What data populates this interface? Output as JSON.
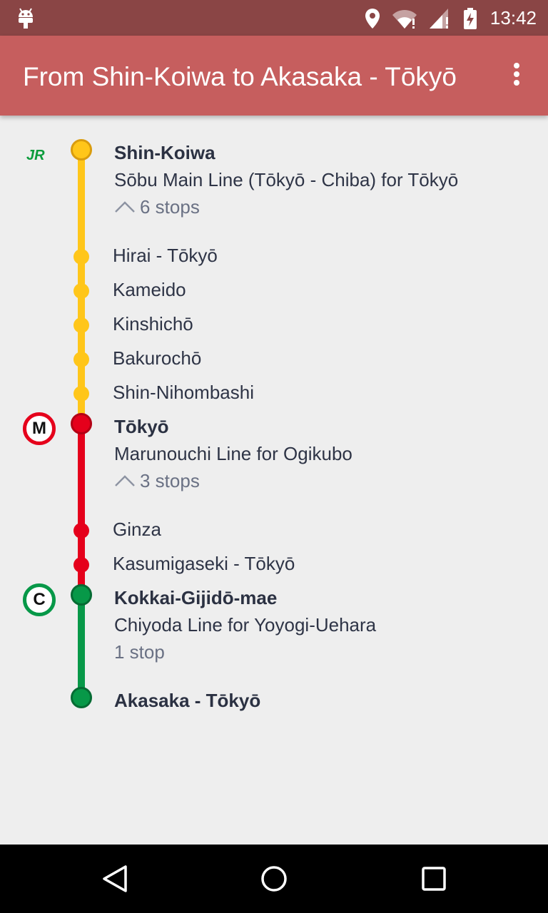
{
  "status_bar": {
    "time": "13:42"
  },
  "toolbar": {
    "title": "From Shin-Koiwa to Akasaka - Tōkyō"
  },
  "colors": {
    "sobu": "#ffc61a",
    "sobu_border": "#d99c0e",
    "marunouchi": "#e5001b",
    "marunouchi_border": "#b30015",
    "chiyoda": "#079848",
    "chiyoda_border": "#056b33"
  },
  "route": {
    "leg1": {
      "operator_badge": "JR",
      "station": "Shin-Koiwa",
      "line": "Sōbu Main Line (Tōkyō - Chiba) for Tōkyō",
      "stops_label": "6 stops",
      "intermediate": [
        "Hirai - Tōkyō",
        "Kameido",
        "Kinshichō",
        "Bakurochō",
        "Shin-Nihombashi"
      ]
    },
    "leg2": {
      "operator_badge": "M",
      "station": "Tōkyō",
      "line": "Marunouchi Line for Ogikubo",
      "stops_label": "3 stops",
      "intermediate": [
        "Ginza",
        "Kasumigaseki - Tōkyō"
      ]
    },
    "leg3": {
      "operator_badge": "C",
      "station": "Kokkai-Gijidō-mae",
      "line": "Chiyoda Line for Yoyogi-Uehara",
      "stops_label": "1 stop"
    },
    "destination": "Akasaka - Tōkyō"
  }
}
